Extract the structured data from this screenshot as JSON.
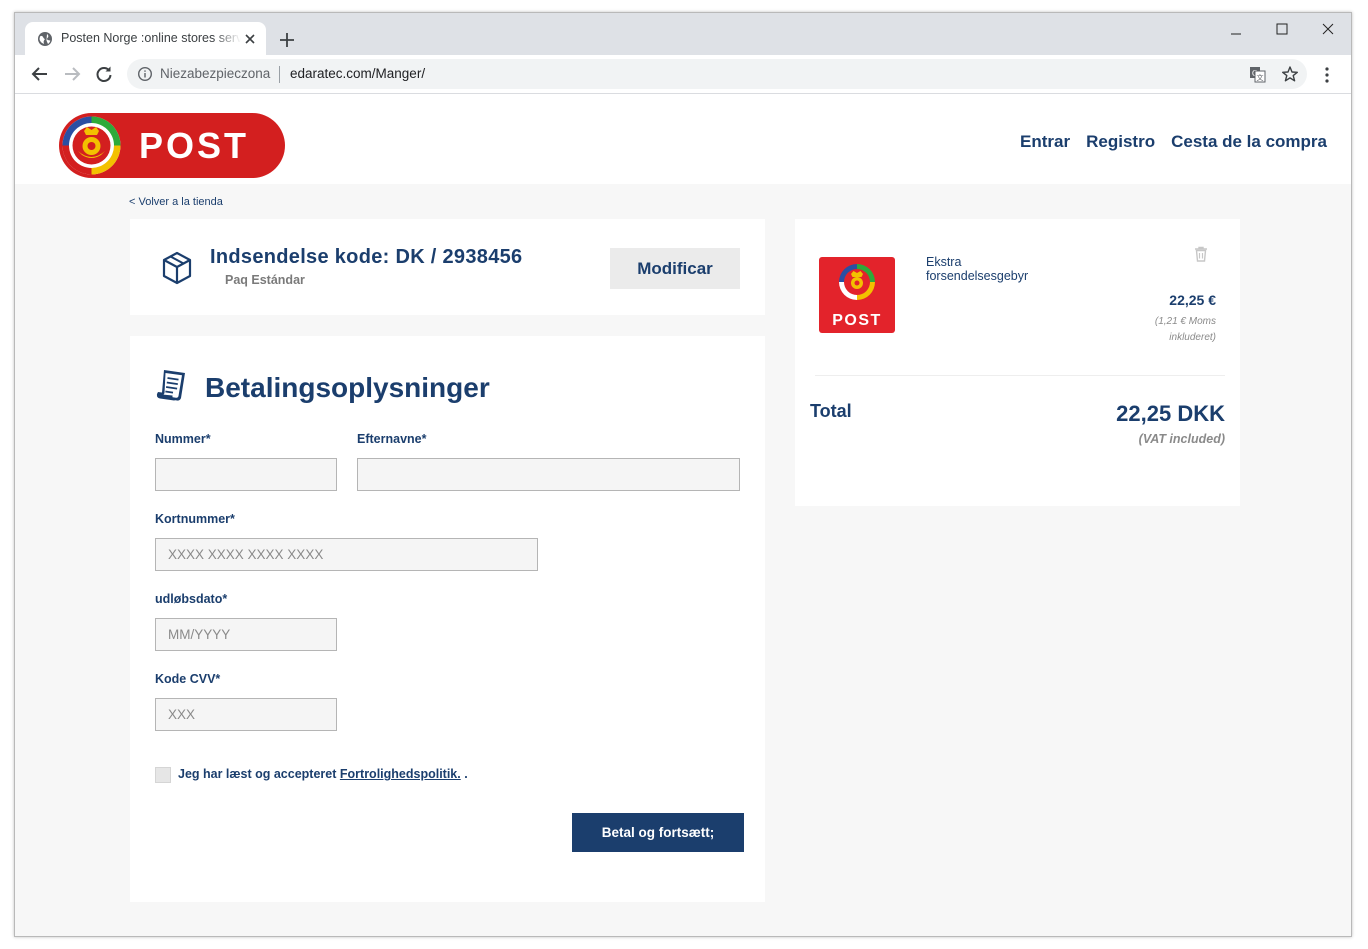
{
  "browser": {
    "tab_title": "Posten Norge :online stores services",
    "security_label": "Niezabezpieczona",
    "url": "edaratec.com/Manger/"
  },
  "header": {
    "logo_text": "POST",
    "nav": [
      "Entrar",
      "Registro",
      "Cesta de la compra"
    ]
  },
  "back_link": "< Volver a la tienda",
  "shipment": {
    "title": "Indsendelse kode: DK / 2938456",
    "subtitle": "Paq Estándar",
    "modify_label": "Modificar"
  },
  "payment": {
    "title": "Betalingsoplysninger",
    "fields": {
      "first_name": {
        "label": "Nummer*",
        "value": "",
        "placeholder": ""
      },
      "last_name": {
        "label": "Efternavne*",
        "value": "",
        "placeholder": ""
      },
      "card_number": {
        "label": "Kortnummer*",
        "value": "",
        "placeholder": "XXXX XXXX XXXX XXXX"
      },
      "expiry": {
        "label": "udløbsdato*",
        "value": "",
        "placeholder": "MM/YYYY"
      },
      "cvv": {
        "label": "Kode CVV*",
        "value": "",
        "placeholder": "XXX"
      }
    },
    "consent_text": "Jeg har læst og accepteret",
    "consent_link": "Fortrolighedspolitik.",
    "consent_end": ".",
    "submit_label": "Betal og fortsætt;"
  },
  "summary": {
    "item_name": "Ekstra forsendelsesgebyr",
    "item_price": "22,25 €",
    "item_vat": "(1,21 € Moms inkluderet)",
    "item_logo_text": "POST",
    "total_label": "Total",
    "total_amount": "22,25 DKK",
    "total_vat": "(VAT included)"
  },
  "colors": {
    "brand_navy": "#1b3e6d",
    "post_red": "#d31f1f",
    "page_bg": "#f7f7f7"
  }
}
